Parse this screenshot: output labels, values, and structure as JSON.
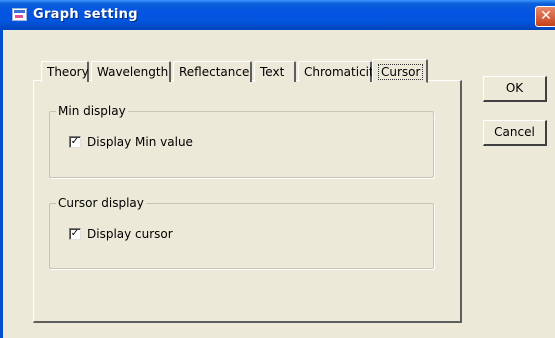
{
  "window": {
    "title": "Graph setting",
    "close_glyph": "✕",
    "icon": "app-graph-icon"
  },
  "tabs": [
    {
      "label": "Theory",
      "active": false
    },
    {
      "label": "Wavelength",
      "active": false
    },
    {
      "label": "Reflectance",
      "active": false
    },
    {
      "label": "Text",
      "active": false
    },
    {
      "label": "Chromaticity",
      "active": false
    },
    {
      "label": "Cursor",
      "active": true
    }
  ],
  "groups": {
    "min_display": {
      "title": "Min display",
      "checkbox": {
        "label": "Display Min value",
        "checked": true,
        "glyph": "✓"
      }
    },
    "cursor_display": {
      "title": "Cursor display",
      "checkbox": {
        "label": "Display cursor",
        "checked": true,
        "glyph": "✓"
      }
    }
  },
  "buttons": {
    "ok": "OK",
    "cancel": "Cancel"
  },
  "colors": {
    "titlebar": "#0554e3",
    "dialog_bg": "#ece9d8",
    "close_button": "#c6401a"
  }
}
